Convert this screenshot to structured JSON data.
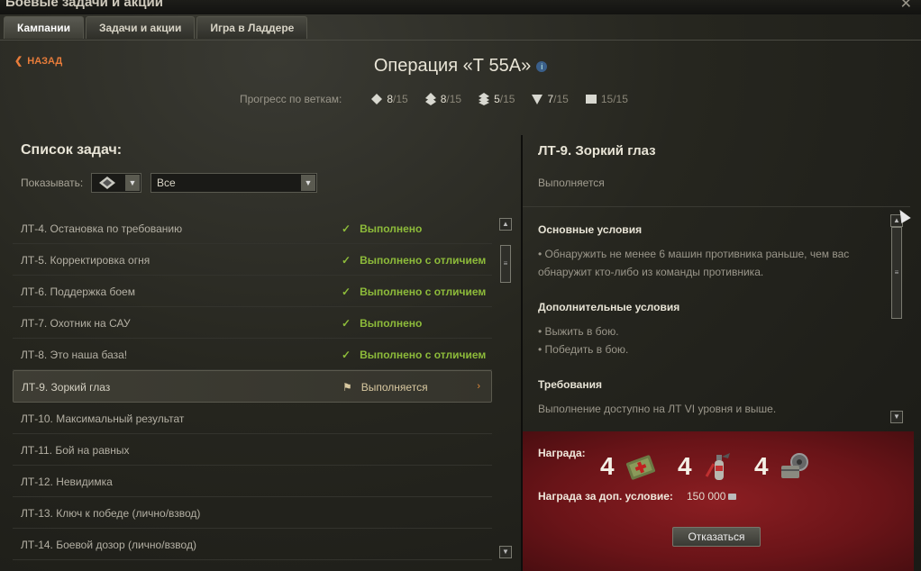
{
  "window": {
    "title": "Боевые задачи и акции",
    "close_glyph": "✕"
  },
  "tabs": [
    {
      "label": "Кампании",
      "active": true
    },
    {
      "label": "Задачи и акции",
      "active": false
    },
    {
      "label": "Игра в Ладдере",
      "active": false
    }
  ],
  "header": {
    "back_label": "НАЗАД",
    "back_icon": "chevron-left-icon",
    "title": "Операция «Т 55А»",
    "info_icon": "info-icon",
    "progress_label": "Прогресс по веткам:",
    "progress": [
      {
        "icon": "lt-class-icon",
        "value": "8",
        "total": "/15"
      },
      {
        "icon": "st-class-icon",
        "value": "8",
        "total": "/15"
      },
      {
        "icon": "tt-class-icon",
        "value": "5",
        "total": "/15"
      },
      {
        "icon": "pt-sau-class-icon",
        "value": "7",
        "total": "/15"
      },
      {
        "icon": "sau-class-icon",
        "value": "15",
        "total": "/15"
      }
    ]
  },
  "list": {
    "title": "Список задач:",
    "show_label": "Показывать:",
    "filter_value": "Все",
    "tasks": [
      {
        "name": "ЛТ-4. Остановка по требованию",
        "status": "Выполнено",
        "state": "done"
      },
      {
        "name": "ЛТ-5. Корректировка огня",
        "status": "Выполнено с отличием",
        "state": "done"
      },
      {
        "name": "ЛТ-6. Поддержка боем",
        "status": "Выполнено с отличием",
        "state": "done"
      },
      {
        "name": "ЛТ-7. Охотник на САУ",
        "status": "Выполнено",
        "state": "done"
      },
      {
        "name": "ЛТ-8. Это наша база!",
        "status": "Выполнено с отличием",
        "state": "done"
      },
      {
        "name": "ЛТ-9. Зоркий глаз",
        "status": "Выполняется",
        "state": "active"
      },
      {
        "name": "ЛТ-10. Максимальный результат",
        "status": "",
        "state": "none"
      },
      {
        "name": "ЛТ-11. Бой на равных",
        "status": "",
        "state": "none"
      },
      {
        "name": "ЛТ-12. Невидимка",
        "status": "",
        "state": "none"
      },
      {
        "name": "ЛТ-13. Ключ к победе (лично/взвод)",
        "status": "",
        "state": "none"
      },
      {
        "name": "ЛТ-14. Боевой дозор (лично/взвод)",
        "status": "",
        "state": "none"
      }
    ]
  },
  "detail": {
    "title": "ЛТ-9. Зоркий глаз",
    "status": "Выполняется",
    "main_conditions_title": "Основные условия",
    "main_conditions": [
      "• Обнаружить не менее 6 машин противника раньше, чем вас обнаружит кто-либо из команды противника."
    ],
    "extra_conditions_title": "Дополнительные условия",
    "extra_conditions": [
      "• Выжить в бою.",
      "• Победить в бою."
    ],
    "requirements_title": "Требования",
    "requirements": "Выполнение доступно на ЛТ VI уровня и выше."
  },
  "reward": {
    "label": "Награда:",
    "items": [
      {
        "count": "4",
        "icon": "repair-kit-icon"
      },
      {
        "count": "4",
        "icon": "fire-extinguisher-icon"
      },
      {
        "count": "4",
        "icon": "toolbox-icon"
      }
    ],
    "extra_label": "Награда за доп. условие:",
    "extra_value": "150 000",
    "extra_icon": "credits-icon",
    "refuse_label": "Отказаться"
  },
  "colors": {
    "done_status": "#8dbb3a",
    "active_status": "#d8c8a0",
    "accent_orange": "#e87c3a",
    "reward_bg": "#7a1a1e"
  }
}
